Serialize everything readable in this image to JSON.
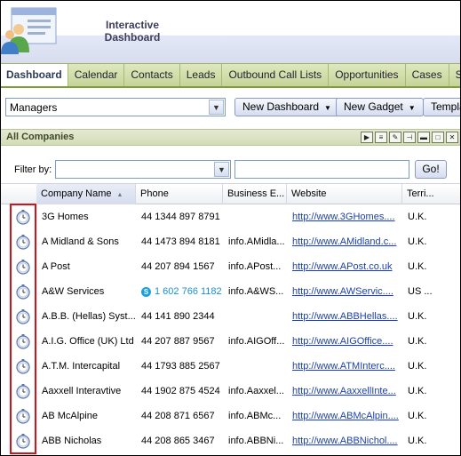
{
  "app": {
    "title_line1": "Interactive",
    "title_line2": "Dashboard"
  },
  "tabs": [
    "Dashboard",
    "Calendar",
    "Contacts",
    "Leads",
    "Outbound Call Lists",
    "Opportunities",
    "Cases",
    "Solutio"
  ],
  "toolbar": {
    "dashboard_select": "Managers",
    "new_dashboard": "New Dashboard",
    "new_gadget": "New Gadget",
    "templates": "Templa"
  },
  "panel": {
    "title": "All Companies"
  },
  "filter": {
    "label": "Filter by:",
    "select_value": "",
    "input_value": "",
    "go": "Go!"
  },
  "grid": {
    "columns": [
      "Company Name",
      "Phone",
      "Business E...",
      "Website",
      "Terri..."
    ],
    "rows": [
      {
        "company": "3G Homes",
        "phone": "44 1344 897 8791",
        "email": "",
        "website": "http://www.3GHomes....",
        "territory": "U.K."
      },
      {
        "company": "A Midland & Sons",
        "phone": "44 1473 894 8181",
        "email": "info.AMidla...",
        "website": "http://www.AMidland.c...",
        "territory": "U.K."
      },
      {
        "company": "A Post",
        "phone": "44 207 894 1567",
        "email": "info.APost...",
        "website": "http://www.APost.co.uk",
        "territory": "U.K."
      },
      {
        "company": "A&W Services",
        "phone": "1 602 766 1182",
        "email": "info.A&WS...",
        "website": "http://www.AWServic....",
        "territory": "US ..."
      },
      {
        "company": "A.B.B. (Hellas) Syst...",
        "phone": "44 141 890 2344",
        "email": "",
        "website": "http://www.ABBHellas....",
        "territory": "U.K."
      },
      {
        "company": "A.I.G. Office (UK) Ltd",
        "phone": "44 207 887 9567",
        "email": "info.AIGOff...",
        "website": "http://www.AIGOffice....",
        "territory": "U.K."
      },
      {
        "company": "A.T.M. Intercapital",
        "phone": "44 1793 885 2567",
        "email": "",
        "website": "http://www.ATMInterc....",
        "territory": "U.K."
      },
      {
        "company": "Aaxxell Interavtive",
        "phone": "44 1902 875 4524",
        "email": "info.Aaxxel...",
        "website": "http://www.AaxxellInte...",
        "territory": "U.K."
      },
      {
        "company": "AB McAlpine",
        "phone": "44 208 871 6567",
        "email": "info.ABMc...",
        "website": "http://www.ABMcAlpin....",
        "territory": "U.K."
      },
      {
        "company": "ABB Nicholas",
        "phone": "44 208 865 3467",
        "email": "info.ABBNi...",
        "website": "http://www.ABBNichol....",
        "territory": "U.K."
      }
    ]
  }
}
